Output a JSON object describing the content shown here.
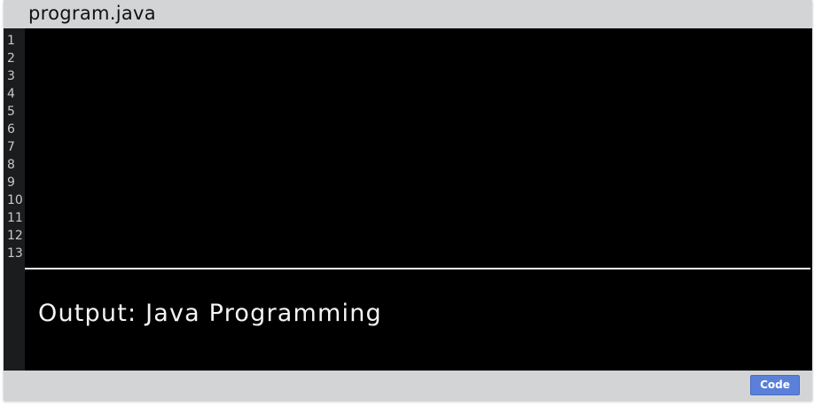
{
  "window": {
    "title": "program.java"
  },
  "editor": {
    "line_numbers": [
      "1",
      "2",
      "3",
      "4",
      "5",
      "6",
      "7",
      "8",
      "9",
      "10",
      "11",
      "12",
      "13"
    ]
  },
  "output": {
    "text": "Output: Java Programming"
  },
  "statusbar": {
    "code_button_label": "Code"
  },
  "colors": {
    "chrome": "#d3d4d6",
    "editor_bg": "#000000",
    "gutter_bg": "#1b1c1e",
    "accent": "#5b80d9"
  }
}
